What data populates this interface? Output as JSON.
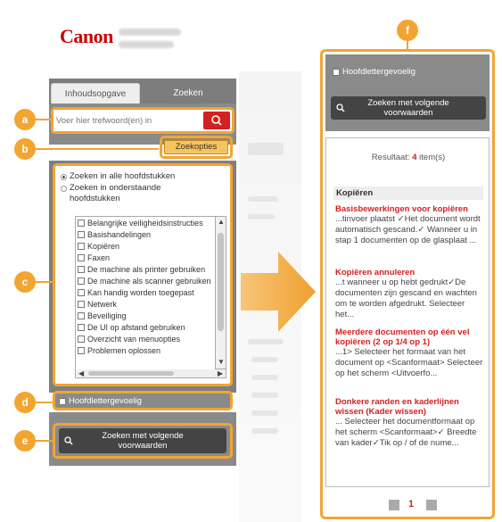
{
  "logo": "Canon",
  "tabs": [
    {
      "label": "Inhoudsopgave"
    },
    {
      "label": "Zoeken"
    }
  ],
  "search": {
    "placeholder": "Voer hier trefwoord(en) in",
    "options_label": "Zoekopties"
  },
  "scope": {
    "all_label": "Zoeken in alle hoofdstukken",
    "below_label": "Zoeken in onderstaande hoofdstukken"
  },
  "chapters": [
    "Belangrijke veiligheidsinstructies",
    "Basishandelingen",
    "Kopiëren",
    "Faxen",
    "De machine als printer gebruiken",
    "De machine als scanner gebruiken",
    "Kan handig worden toegepast",
    "Netwerk",
    "Beveiliging",
    "De UI op afstand gebruiken",
    "Overzicht van menuopties",
    "Problemen oplossen"
  ],
  "case_label": "Hoofdlettergevoelig",
  "cond_button_line1": "Zoeken met volgende",
  "cond_button_line2": "voorwaarden",
  "badges": [
    "a",
    "b",
    "c",
    "d",
    "e",
    "f"
  ],
  "results": {
    "count_prefix": "Resultaat:",
    "count_num": "4",
    "count_suffix": "item(s)",
    "category": "Kopiëren",
    "items": [
      {
        "title": "Basisbewerkingen voor kopiëren",
        "snippet": "...tinvoer plaatst ✓Het document wordt automatisch gescand.✓ Wanneer u in stap 1 documenten op de glasplaat ..."
      },
      {
        "title": "Kopiëren annuleren",
        "snippet": "...t wanneer u op  hebt gedrukt✓De documenten zijn gescand en wachten om te worden afgedrukt. Selecteer het..."
      },
      {
        "title": "Meerdere documenten op één vel kopiëren (2 op 1/4 op 1)",
        "snippet": "...1> Selecteer het formaat van het document op <Scanformaat> Selecteer op het scherm <Uitvoerfo..."
      },
      {
        "title": "Donkere randen en kaderlijnen wissen (Kader wissen)",
        "snippet": "... Selecteer het documentformaat op het scherm <Scanformaat>✓ Breedte van kader✓Tik op / of de nume..."
      }
    ],
    "page": "1"
  },
  "colors": {
    "accent": "#f2a531",
    "brand_red": "#cc0000",
    "result_title": "#d42020"
  }
}
